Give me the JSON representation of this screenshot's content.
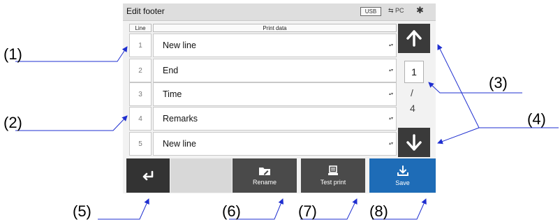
{
  "window": {
    "title": "Edit footer"
  },
  "status": {
    "usb": "USB",
    "pc": "PC",
    "bluetooth": "✱"
  },
  "table": {
    "headers": [
      "Line",
      "Print data"
    ],
    "rows": [
      {
        "line": "1",
        "value": "New line"
      },
      {
        "line": "2",
        "value": "End"
      },
      {
        "line": "3",
        "value": "Time"
      },
      {
        "line": "4",
        "value": "Remarks"
      },
      {
        "line": "5",
        "value": "New line"
      }
    ]
  },
  "pager": {
    "current": "1",
    "separator": "/",
    "total": "4"
  },
  "toolbar": {
    "rename": "Rename",
    "test_print": "Test print",
    "save": "Save"
  },
  "callouts": [
    "(1)",
    "(2)",
    "(3)",
    "(4)",
    "(5)",
    "(6)",
    "(7)",
    "(8)"
  ],
  "colors": {
    "accent": "#1e6cb7",
    "dark_button": "#3a3a3a",
    "callout_line": "#1f2fd0"
  }
}
